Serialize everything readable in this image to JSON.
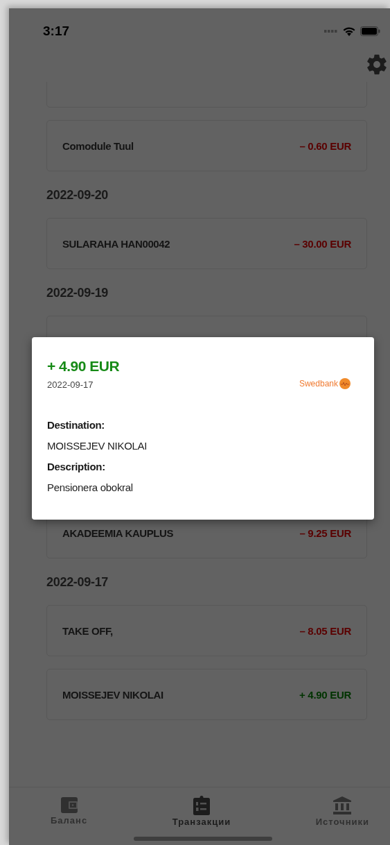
{
  "status_bar": {
    "time": "3:17"
  },
  "sections": [
    {
      "items": [
        {
          "kind": "covered"
        },
        {
          "kind": "tx",
          "name": "Comodule Tuul",
          "amount": "– 0.60 EUR",
          "color": "#5a0000"
        }
      ]
    },
    {
      "date": "2022-09-20",
      "items": [
        {
          "kind": "tx",
          "name": "SULARAHA HAN00042",
          "amount": "– 30.00 EUR",
          "color": "#5a0000"
        }
      ]
    },
    {
      "date": "2022-09-19",
      "items": [
        {
          "kind": "covered"
        },
        {
          "kind": "covered"
        },
        {
          "kind": "covered"
        },
        {
          "kind": "tx",
          "name": "AKADEEMIA KAUPLUS",
          "amount": "– 9.25 EUR",
          "color": "#5a0000"
        }
      ]
    },
    {
      "date": "2022-09-17",
      "items": [
        {
          "kind": "tx",
          "name": "TAKE OFF,",
          "amount": "– 8.05 EUR",
          "color": "#5a0000"
        },
        {
          "kind": "tx",
          "name": "MOISSEJEV NIKOLAI",
          "amount": "+ 4.90 EUR",
          "color": "#003300"
        }
      ]
    }
  ],
  "detail": {
    "amount": "+ 4.90 EUR",
    "color": "#168a16",
    "date": "2022-09-17",
    "bank": "Swedbank",
    "fields": [
      {
        "label": "Destination:",
        "value": "MOISSEJEV NIKOLAI"
      },
      {
        "label": "Description:",
        "value": "Pensionera obokral"
      }
    ]
  },
  "tabs": [
    {
      "label": "Баланс",
      "selected": false
    },
    {
      "label": "Транзакции",
      "selected": true
    },
    {
      "label": "Источники",
      "selected": false
    }
  ]
}
